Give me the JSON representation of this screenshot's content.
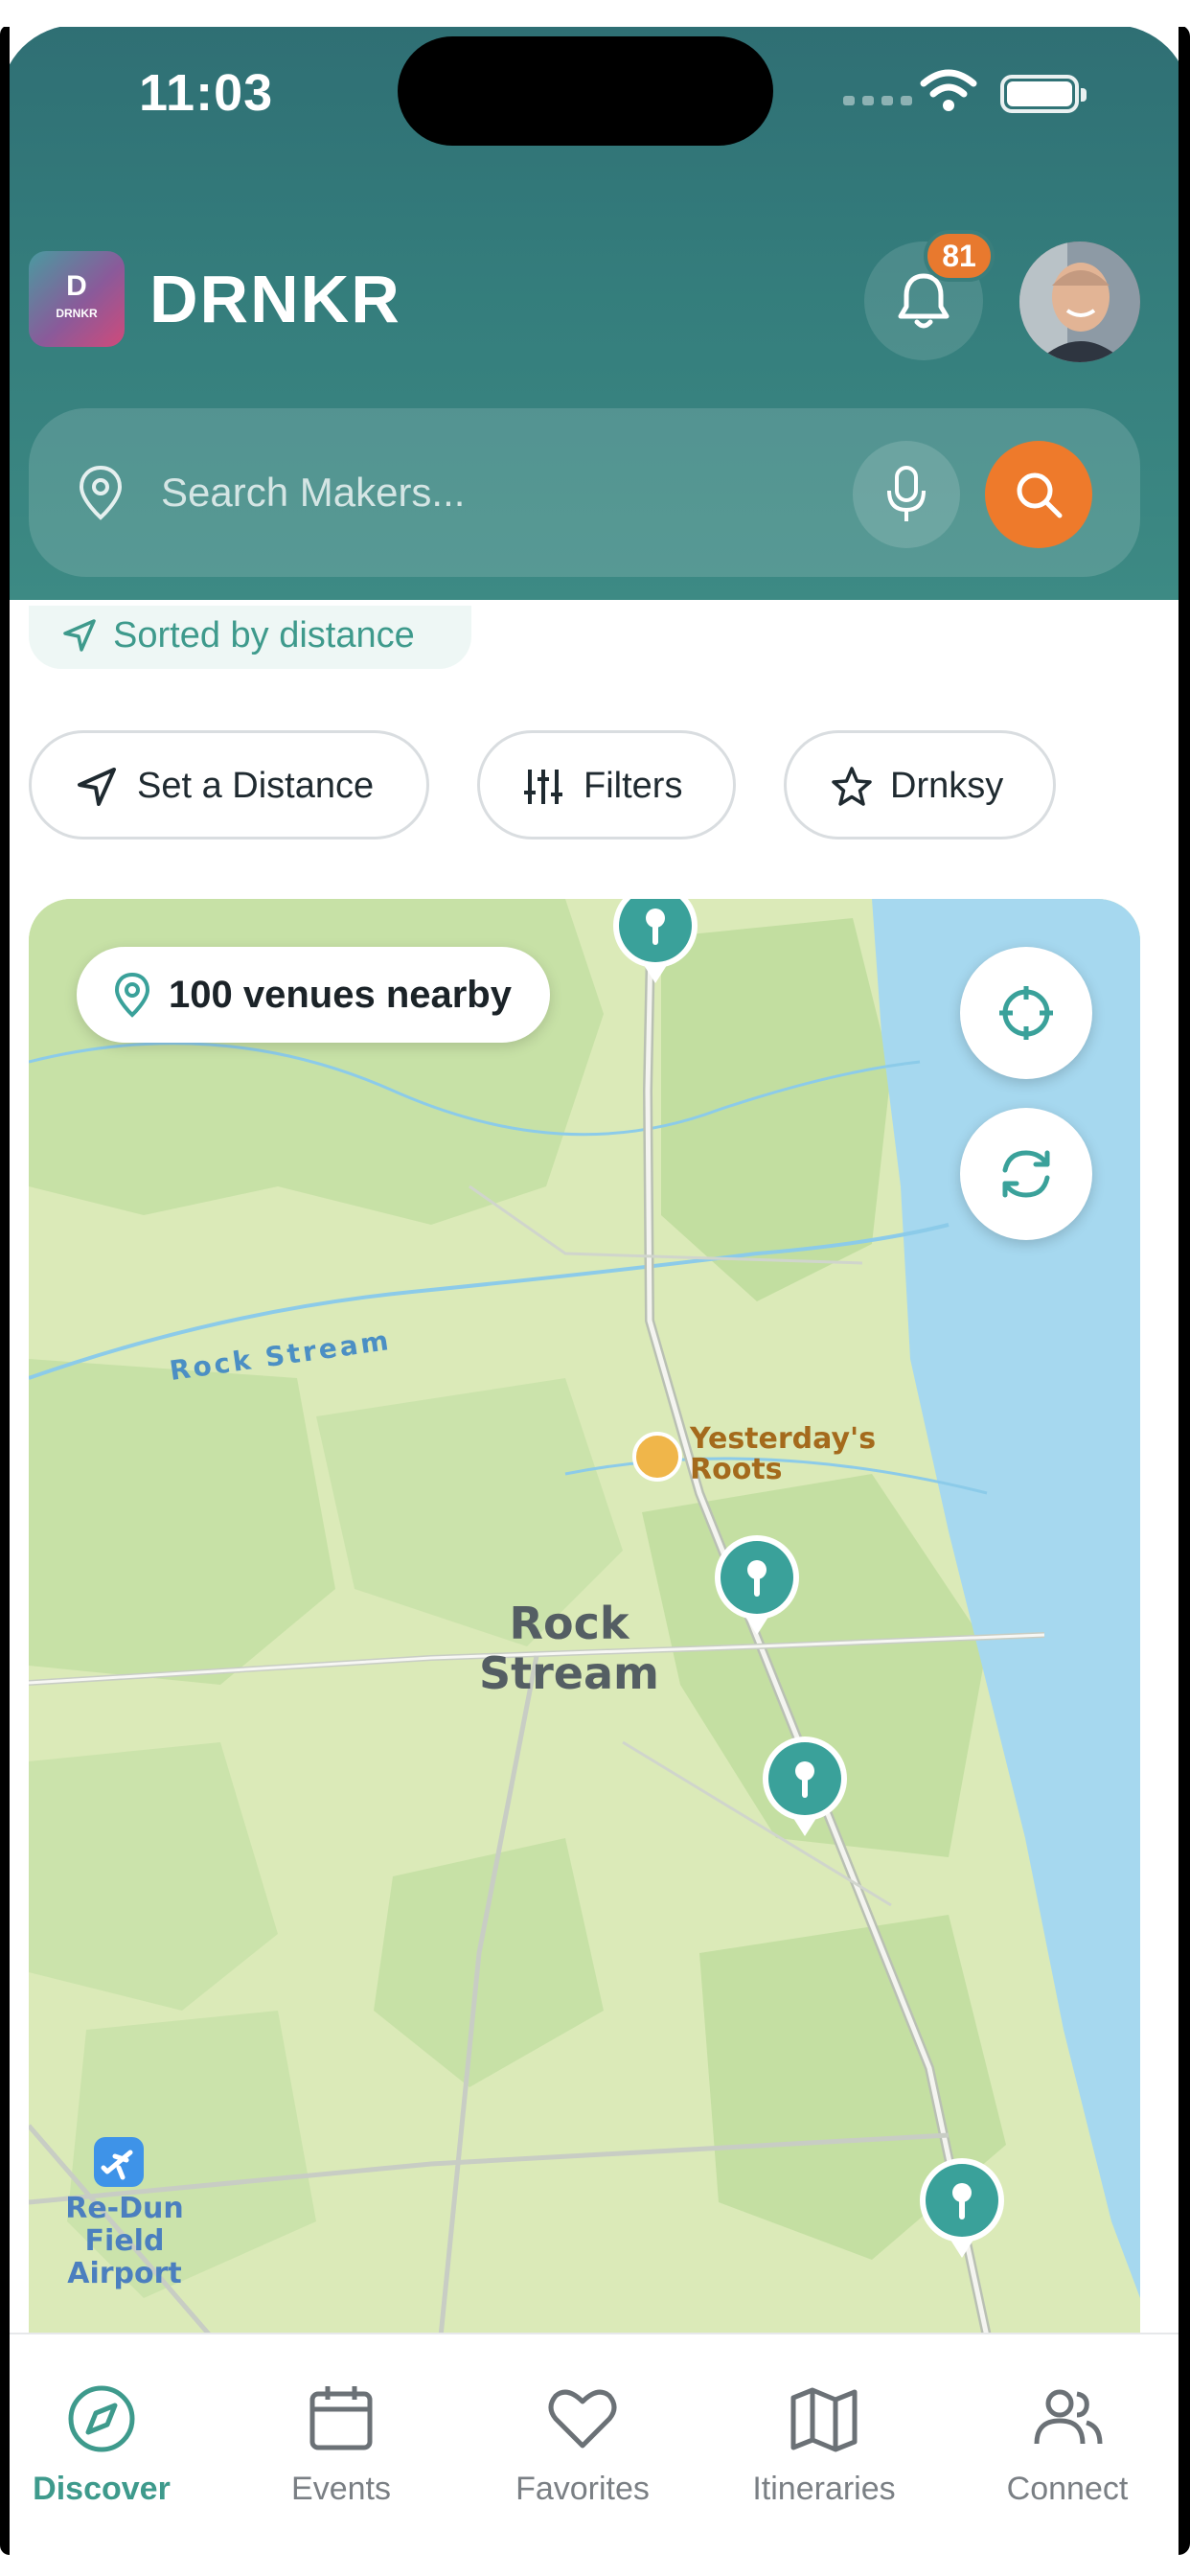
{
  "status_bar": {
    "time": "11:03"
  },
  "header": {
    "logo": {
      "letter": "D",
      "small": "DRNKR"
    },
    "app_title": "DRNKR",
    "notifications_count": "81"
  },
  "search": {
    "placeholder": "Search Makers..."
  },
  "sort": {
    "label": "Sorted by distance"
  },
  "chips": [
    {
      "label": "Set a Distance",
      "icon": "navigation-arrow-icon"
    },
    {
      "label": "Filters",
      "icon": "sliders-icon"
    },
    {
      "label": "Drnksy",
      "icon": "star-icon"
    }
  ],
  "map": {
    "venues_label": "100 venues nearby",
    "labels": {
      "stream": "Rock Stream",
      "town_line1": "Rock",
      "town_line2": "Stream",
      "poi_line1": "Yesterday's",
      "poi_line2": "Roots",
      "airport_line1": "Re-Dun Field",
      "airport_line2": "Airport"
    },
    "colors": {
      "land": "#dbeab8",
      "forest": "#c4e0a4",
      "water": "#a4d8ef",
      "marker": "#3aa19a"
    }
  },
  "tabs": [
    {
      "label": "Discover",
      "active": true
    },
    {
      "label": "Events",
      "active": false
    },
    {
      "label": "Favorites",
      "active": false
    },
    {
      "label": "Itineraries",
      "active": false
    },
    {
      "label": "Connect",
      "active": false
    }
  ],
  "colors": {
    "brand_teal": "#347d7c",
    "accent_orange": "#ee7a2b",
    "active_tab": "#3e9a8c"
  }
}
